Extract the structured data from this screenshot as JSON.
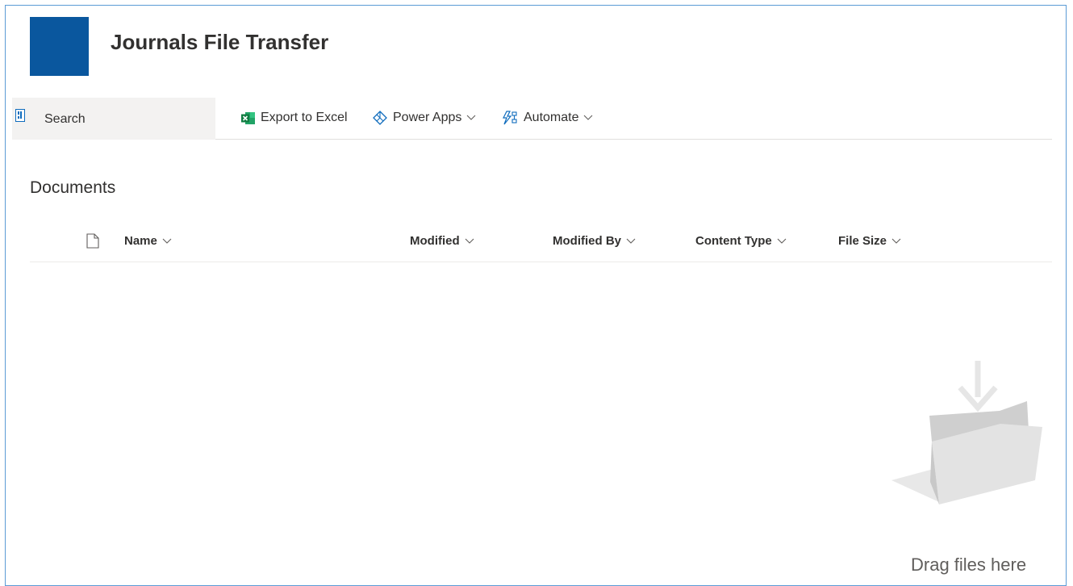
{
  "site": {
    "title": "Journals File Transfer",
    "logo_color": "#0a579e"
  },
  "search": {
    "label": "Search"
  },
  "commands": [
    {
      "label": "Export to Excel",
      "icon": "excel-icon"
    },
    {
      "label": "Power Apps",
      "icon": "power-apps-icon",
      "has_dropdown": true
    },
    {
      "label": "Automate",
      "icon": "automate-icon",
      "has_dropdown": true
    }
  ],
  "library": {
    "title": "Documents"
  },
  "columns": [
    {
      "label": "Name"
    },
    {
      "label": "Modified"
    },
    {
      "label": "Modified By"
    },
    {
      "label": "Content Type"
    },
    {
      "label": "File Size"
    }
  ],
  "empty_state": {
    "message": "Drag files here"
  },
  "colors": {
    "accent": "#0a579e",
    "border": "#5b9bd5",
    "excel": "#107c41",
    "brand_blue": "#0f6cbd"
  }
}
